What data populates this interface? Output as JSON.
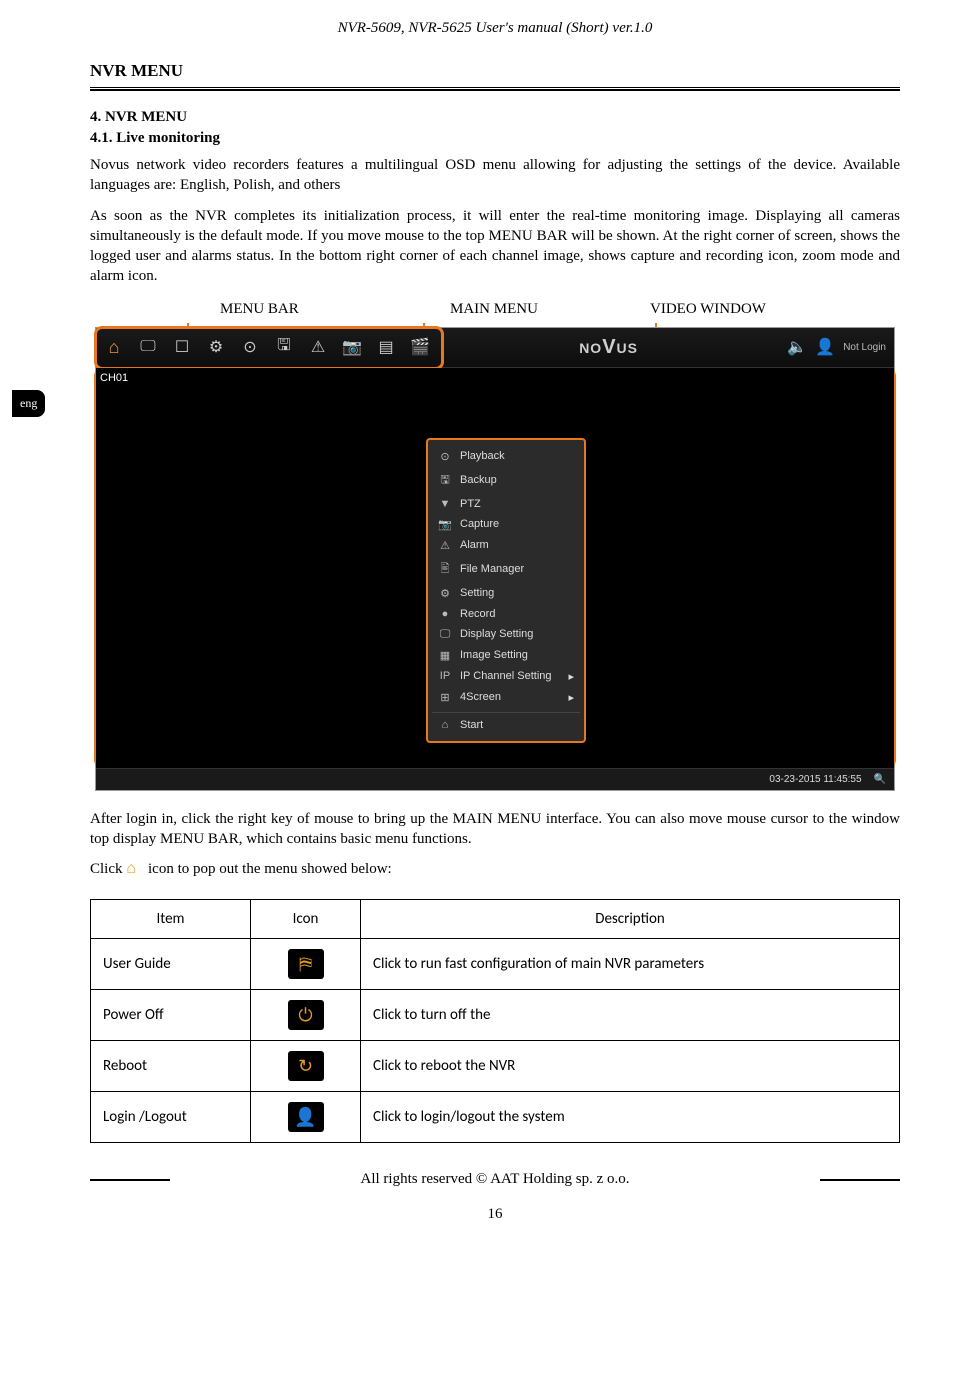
{
  "header": "NVR-5609, NVR-5625 User's manual (Short) ver.1.0",
  "side_tab": "eng",
  "section_title": "NVR MENU",
  "h4_num": "4. NVR MENU",
  "h41_num": "4.1. Live monitoring",
  "para1": "Novus network video recorders features a multilingual OSD menu allowing for adjusting the settings of the device. Available languages are: English, Polish, and others",
  "para2": "As soon as the NVR completes its initialization process, it will enter the real-time monitoring image. Displaying all cameras simultaneously is the default mode. If you move mouse to the top MENU BAR will be shown. At the right corner of screen, shows the logged user and alarms status. In the bottom right corner of each channel image, shows capture and recording icon, zoom mode and alarm icon.",
  "labels": {
    "menu_bar": "MENU BAR",
    "main_menu": "MAIN MENU",
    "video_window": "VIDEO WINDOW"
  },
  "nvr": {
    "brand": "NOVUS",
    "not_login": "Not Login",
    "channel": "CH01",
    "timestamp": "03-23-2015  11:45:55",
    "context_items": [
      "Playback",
      "Backup",
      "PTZ",
      "Capture",
      "Alarm",
      "File Manager",
      "Setting",
      "Record",
      "Display Setting",
      "Image Setting",
      "IP Channel Setting",
      "4Screen"
    ],
    "context_start": "Start"
  },
  "para3": "After login in, click the right key of mouse to bring up the MAIN MENU interface. You can also move mouse cursor to the window top display MENU BAR, which contains basic menu functions.",
  "para4a": "Click",
  "para4b": "icon to pop out the menu showed below:",
  "table": {
    "headers": [
      "Item",
      "Icon",
      "Description"
    ],
    "rows": [
      {
        "item": "User Guide",
        "icon": "signpost",
        "desc": "Click to run fast configuration of main NVR parameters"
      },
      {
        "item": "Power Off",
        "icon": "power",
        "desc": "Click to turn off the"
      },
      {
        "item": "Reboot",
        "icon": "reboot",
        "desc": "Click to reboot the NVR"
      },
      {
        "item": "Login /Logout",
        "icon": "user",
        "desc": "Click to login/logout the system"
      }
    ]
  },
  "footer": "All rights reserved © AAT Holding sp. z o.o.",
  "page_number": "16"
}
